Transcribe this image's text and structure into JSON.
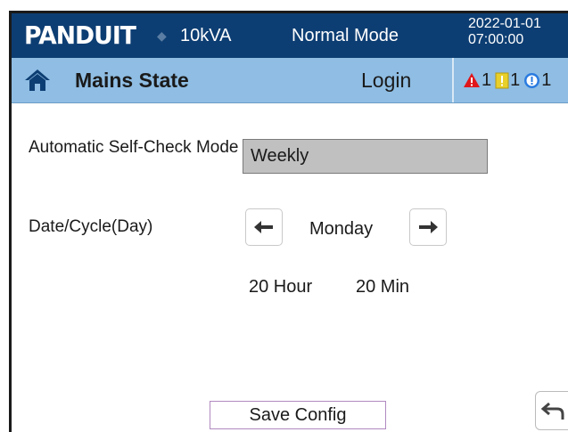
{
  "header": {
    "brand": "PANDUIT",
    "capacity": "10kVA",
    "mode": "Normal Mode",
    "date": "2022-01-01",
    "time": "07:00:00"
  },
  "status_bar": {
    "title": "Mains State",
    "login_label": "Login",
    "alarms": [
      {
        "icon": "warning-triangle-icon",
        "color": "#e0161b",
        "count": "1"
      },
      {
        "icon": "exclamation-square-icon",
        "color": "#e8cf2a",
        "count": "1"
      },
      {
        "icon": "info-circle-icon",
        "color": "#2a7be0",
        "count": "1"
      }
    ]
  },
  "form": {
    "self_check_label": "Automatic Self-Check Mode",
    "self_check_value": "Weekly",
    "date_cycle_label": "Date/Cycle(Day)",
    "day_value": "Monday",
    "hour_value": "20 Hour",
    "min_value": "20 Min"
  },
  "footer": {
    "save_label": "Save Config"
  },
  "colors": {
    "header_bg": "#0d3e73",
    "status_bg": "#8fbde3",
    "field_bg": "#c0c0c0"
  }
}
